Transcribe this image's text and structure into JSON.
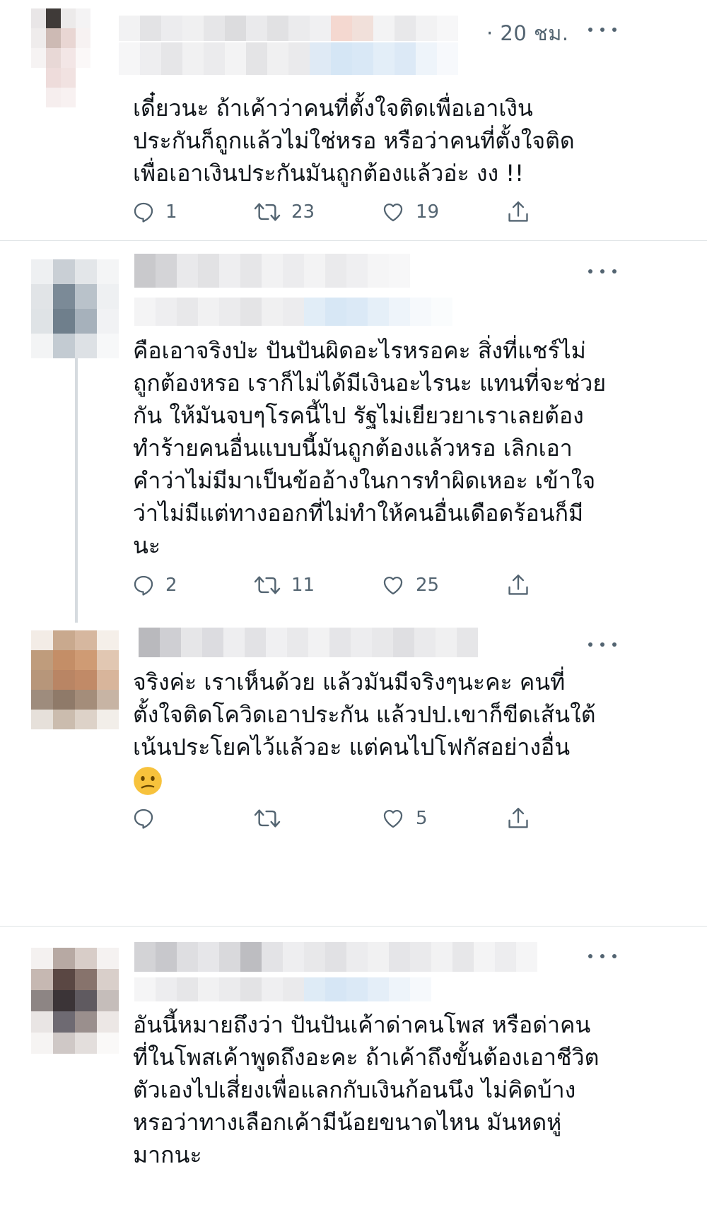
{
  "tweets": [
    {
      "time": "· 20 ชม.",
      "lines": [
        "เดี๋ยวนะ ถ้าเค้าว่าคนที่ตั้งใจติดเพื่อเอาเงิน",
        "ประกันก็ถูกแล้วไม่ใช่หรอ  หรือว่าคนที่ตั้งใจติด",
        "เพื่อเอาเงินประกันมันถูกต้องแล้วอ่ะ  งง !!"
      ],
      "reply_count": "1",
      "retweet_count": "23",
      "like_count": "19"
    },
    {
      "time": "",
      "lines": [
        "คือเอาจริงป่ะ ปันปันผิดอะไรหรอคะ สิ่งที่แชร์ไม่",
        "ถูกต้องหรอ เราก็ไม่ได้มีเงินอะไรนะ แทนที่จะช่วย",
        "กัน ให้มันจบๆโรคนี้ไป รัฐไม่เยียวยาเราเลยต้อง",
        "ทำร้ายคนอื่นแบบนี้มันถูกต้องแล้วหรอ เลิกเอา",
        "คำว่าไม่มีมาเป็นข้ออ้างในการทำผิดเหอะ เข้าใจ",
        "ว่าไม่มีแต่ทางออกที่ไม่ทำให้คนอื่นเดือดร้อนก็มี",
        "นะ"
      ],
      "reply_count": "2",
      "retweet_count": "11",
      "like_count": "25"
    },
    {
      "time": "",
      "lines": [
        "จริงค่ะ เราเห็นด้วย แล้วมันมีจริงๆนะคะ คนที่",
        "ตั้งใจติดโควิดเอาประกัน แล้วปป.เขาก็ขีดเส้นใต้",
        "เน้นประโยคไว้แล้วอะ แต่คนไปโฟกัสอย่างอื่น"
      ],
      "emoji": "confused-face",
      "reply_count": "",
      "retweet_count": "",
      "like_count": "5"
    },
    {
      "time": "",
      "lines": [
        "อันนี้หมายถึงว่า ปันปันเค้าด่าคนโพส หรือด่าคน",
        "ที่ในโพสเค้าพูดถึงอะคะ ถ้าเค้าถึงขั้นต้องเอาชีวิต",
        "ตัวเองไปเสี่ยงเพื่อแลกกับเงินก้อนนึง ไม่คิดบ้าง",
        "หรอว่าทางเลือกเค้ามีน้อยขนาดไหน มันหดหู่",
        "มากนะ"
      ]
    }
  ],
  "colors": {
    "text": "#0f1419",
    "secondary": "#536471",
    "divider": "#dfe3e6",
    "thread_line": "#d6dbdf",
    "emoji_face": "#f7c23c"
  },
  "icons": [
    "reply-icon",
    "retweet-icon",
    "like-icon",
    "share-icon",
    "more-options-icon"
  ]
}
